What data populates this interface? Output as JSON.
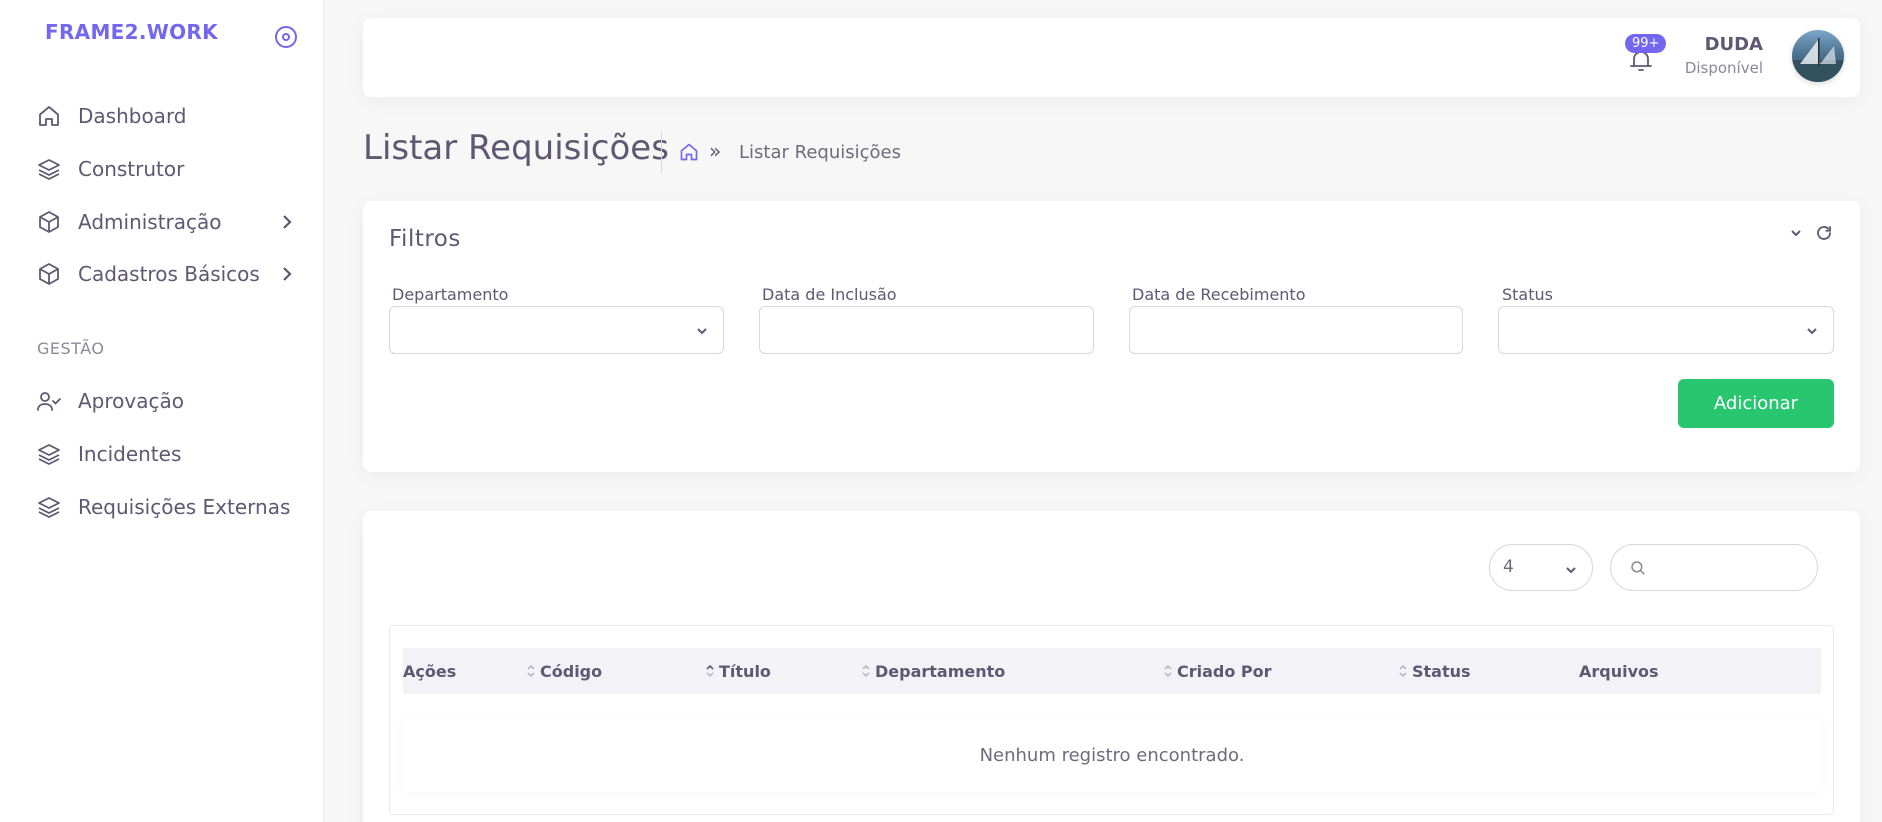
{
  "brand": {
    "name": "FRAME2.WORK",
    "accent": "#7367f0"
  },
  "sidebar": {
    "items": [
      {
        "label": "Dashboard",
        "icon": "home-icon"
      },
      {
        "label": "Construtor",
        "icon": "layers-icon"
      },
      {
        "label": "Administração",
        "icon": "package-icon",
        "has_submenu": true
      },
      {
        "label": "Cadastros Básicos",
        "icon": "package-icon",
        "has_submenu": true
      }
    ],
    "section_header": "GESTÃO",
    "section_items": [
      {
        "label": "Aprovação",
        "icon": "user-check-icon"
      },
      {
        "label": "Incidentes",
        "icon": "layers-icon"
      },
      {
        "label": "Requisições Externas",
        "icon": "layers-icon"
      }
    ]
  },
  "topbar": {
    "notification_count": "99+",
    "user_name": "DUDA",
    "user_status": "Disponível"
  },
  "page": {
    "title": "Listar Requisições",
    "breadcrumb_current": "Listar Requisições",
    "breadcrumb_separator": "»"
  },
  "filters": {
    "title": "Filtros",
    "fields": [
      {
        "label": "Departamento",
        "type": "select",
        "value": ""
      },
      {
        "label": "Data de Inclusão",
        "type": "text",
        "value": ""
      },
      {
        "label": "Data de Recebimento",
        "type": "text",
        "value": ""
      },
      {
        "label": "Status",
        "type": "select",
        "value": ""
      }
    ],
    "add_button": "Adicionar",
    "add_button_color": "#28c76f"
  },
  "table": {
    "page_size": "4",
    "search_value": "",
    "columns": [
      "Ações",
      "Código",
      "Título",
      "Departamento",
      "Criado Por",
      "Status",
      "Arquivos"
    ],
    "empty_message": "Nenhum registro encontrado."
  }
}
